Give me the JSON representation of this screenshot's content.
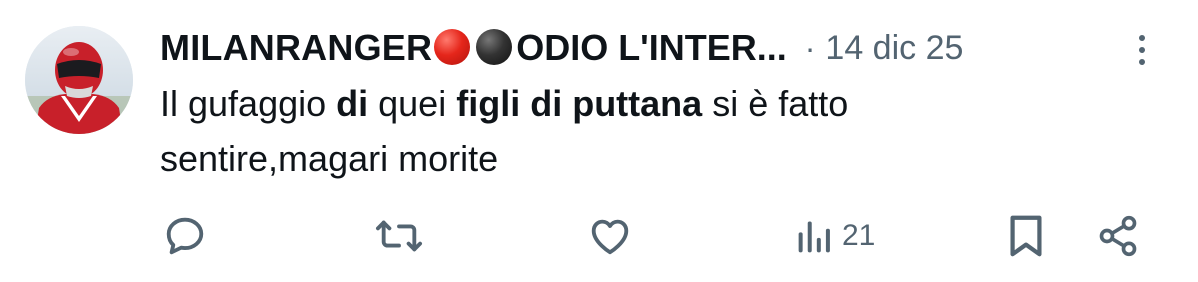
{
  "tweet": {
    "author_name": "MILANRANGER",
    "author_suffix": "ODIO L'INTER...",
    "separator": "·",
    "date": "14 dic 25",
    "text_segments": [
      {
        "text": "Il gufaggio ",
        "bold": false
      },
      {
        "text": "di",
        "bold": true
      },
      {
        "text": " quei ",
        "bold": false
      },
      {
        "text": "figli di puttana",
        "bold": true
      },
      {
        "text": " si è fatto sentire,magari morite",
        "bold": false
      }
    ],
    "text_parts": {
      "p1": "Il gufaggio ",
      "p2": "di",
      "p3": " quei ",
      "p4": "figli di puttana",
      "p5": " si è fatto",
      "p6": "sentire,magari morite"
    },
    "emojis": [
      "red-circle",
      "black-circle"
    ]
  },
  "actions": {
    "reply_icon": "reply-icon",
    "retweet_icon": "retweet-icon",
    "like_icon": "like-icon",
    "views_icon": "views-icon",
    "views_count": "21",
    "bookmark_icon": "bookmark-icon",
    "share_icon": "share-icon"
  },
  "colors": {
    "text_primary": "#0f1419",
    "text_secondary": "#536471",
    "background": "#ffffff"
  }
}
